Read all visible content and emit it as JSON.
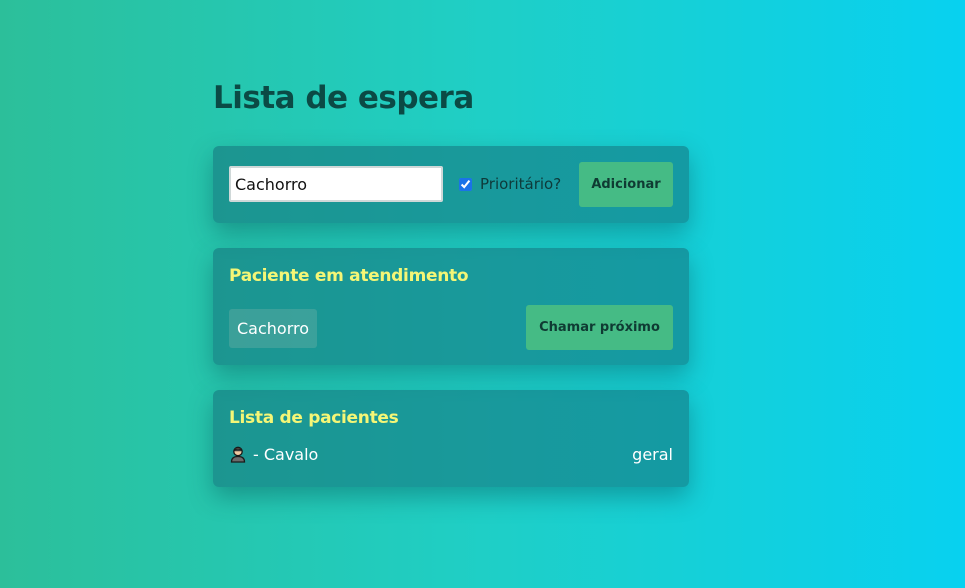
{
  "page": {
    "title": "Lista de espera"
  },
  "form": {
    "name_value": "Cachorro",
    "priority_checked": true,
    "priority_label": "Prioritário?",
    "add_label": "Adicionar"
  },
  "current": {
    "title": "Paciente em atendimento",
    "patient_name": "Cachorro",
    "next_label": "Chamar próximo"
  },
  "patients": {
    "title": "Lista de pacientes",
    "items": [
      {
        "icon": "person-icon",
        "name_text": "- Cavalo",
        "category": "geral"
      }
    ]
  },
  "colors": {
    "title": "#0b4a45",
    "card_title": "#f4f676",
    "button": "#45bb85",
    "gradient_start": "#2cbf9a",
    "gradient_end": "#08d1f0"
  }
}
